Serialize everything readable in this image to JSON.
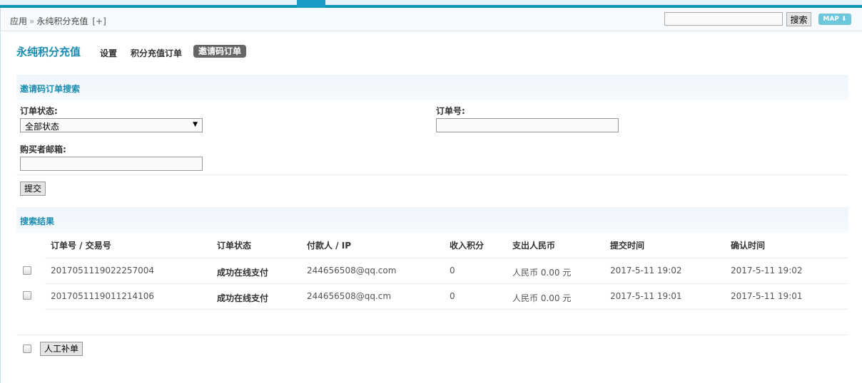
{
  "breadcrumb": {
    "root": "应用",
    "sep": "»",
    "current": "永纯积分充值",
    "add": "[+]"
  },
  "topsearch": {
    "value": "",
    "button": "搜索",
    "map": "MAP ⬇"
  },
  "app": {
    "title": "永纯积分充值",
    "tabs": [
      {
        "label": "设置"
      },
      {
        "label": "积分充值订单"
      },
      {
        "label": "邀请码订单",
        "active": true
      }
    ]
  },
  "search": {
    "title": "邀请码订单搜索",
    "status_label": "订单状态:",
    "status_value": "全部状态",
    "order_label": "订单号:",
    "order_value": "",
    "email_label": "购买者邮箱:",
    "email_value": "",
    "submit": "提交"
  },
  "results": {
    "title": "搜索结果",
    "headers": [
      "订单号 / 交易号",
      "订单状态",
      "付款人 / IP",
      "收入积分",
      "支出人民币",
      "提交时间",
      "确认时间"
    ],
    "rows": [
      [
        "2017051119022257004",
        "成功在线支付",
        "244656508@qq.com",
        "0",
        "人民币 0.00 元",
        "2017-5-11 19:02",
        "2017-5-11 19:02"
      ],
      [
        "2017051119011214106",
        "成功在线支付",
        "244656508@qq.cm",
        "0",
        "人民币 0.00 元",
        "2017-5-11 19:01",
        "2017-5-11 19:01"
      ]
    ],
    "manual_button": "人工补单"
  }
}
